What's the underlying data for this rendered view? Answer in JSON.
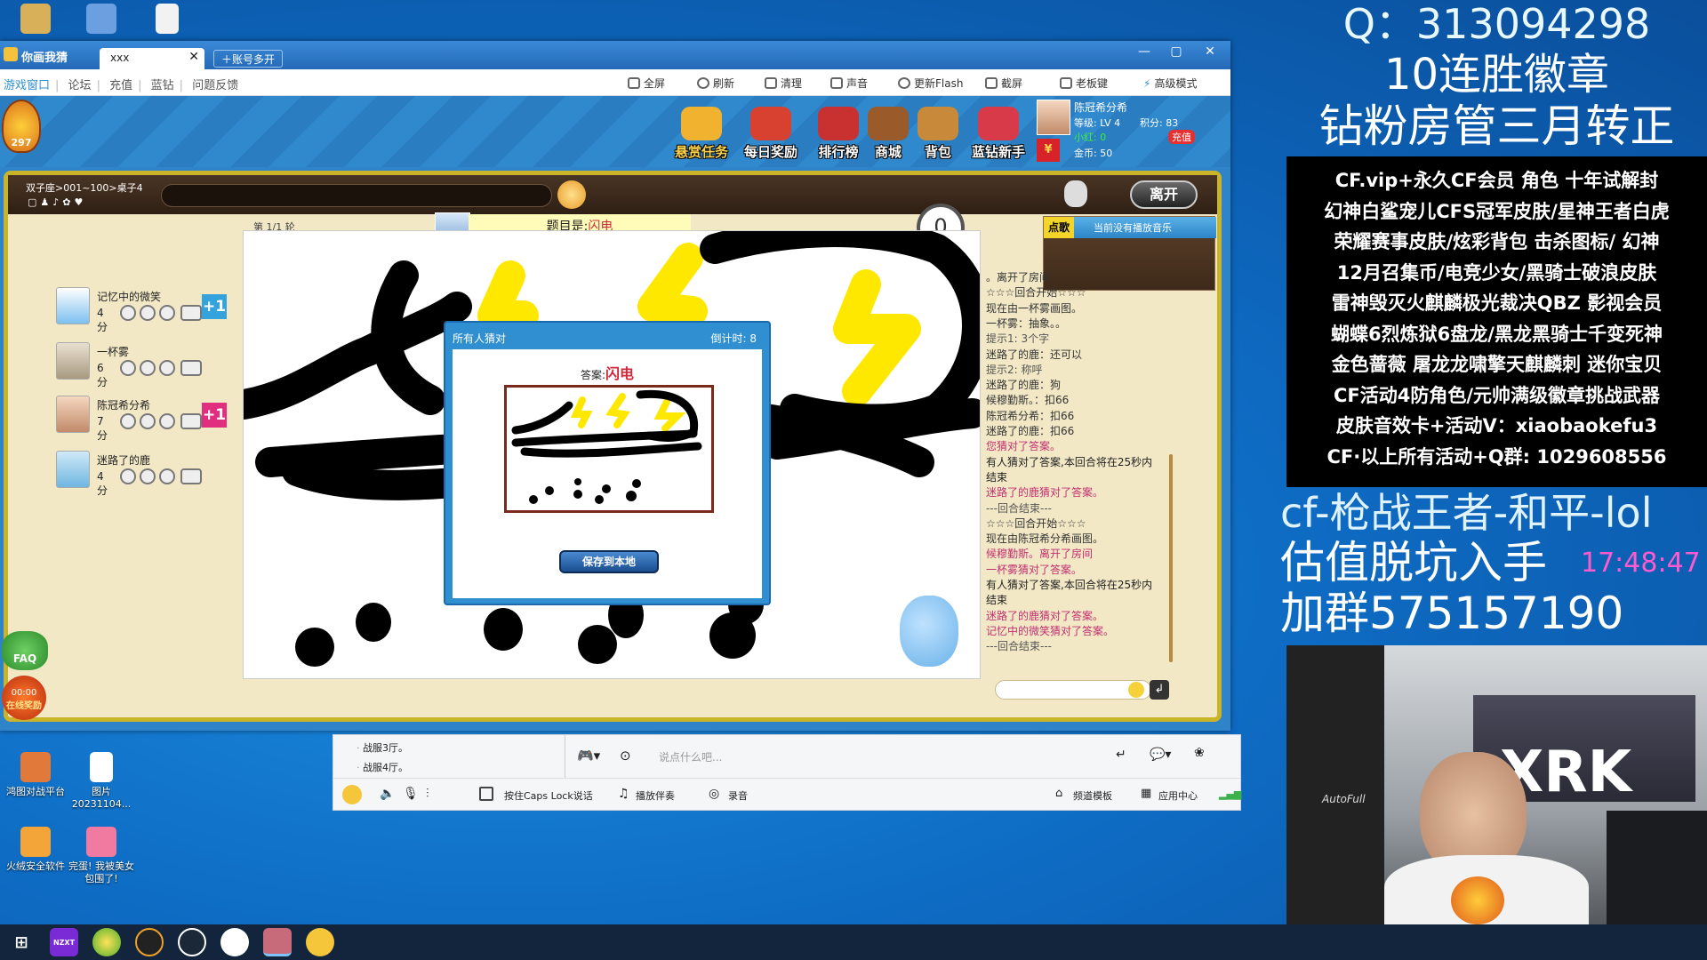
{
  "window": {
    "app_title": "你画我猜",
    "tab_label": "xxx",
    "new_tab_label": "账号多开"
  },
  "menu": {
    "left_links": [
      "游戏窗口",
      "论坛",
      "充值",
      "蓝钻",
      "问题反馈"
    ],
    "tools": [
      "全屏",
      "刷新",
      "清理",
      "声音",
      "更新Flash",
      "截屏",
      "老板键",
      "高级模式"
    ]
  },
  "game": {
    "level_badge": "297",
    "buttons": [
      "悬赏任务",
      "每日奖励",
      "排行榜",
      "商城",
      "背包",
      "蓝钻新手"
    ],
    "user": {
      "name": "陈冠希分希",
      "level": "等级: LV 4",
      "points": "积分: 83",
      "small_red": "小红: 0",
      "recharge": "充值",
      "gold": "金币: 50",
      "vip_mark": "¥"
    },
    "room_path": "双子座>001~100>桌子4",
    "leave_button": "离开",
    "round_label": "第 1/1 轮",
    "topic_label": "题目是:",
    "topic_value": "闪电",
    "timer_value": "0",
    "music_tab": "点歌",
    "music_status": "当前没有播放音乐",
    "faq": "FAQ",
    "online_time": "00:00",
    "online_label": "在线奖励"
  },
  "players": [
    {
      "name": "记忆中的微笑",
      "score": "4分",
      "bonus": "+1",
      "bonus_color": "#34a3dc"
    },
    {
      "name": "一杯雾",
      "score": "6分",
      "bonus": "",
      "bonus_color": ""
    },
    {
      "name": "陈冠希分希",
      "score": "7分",
      "bonus": "+1",
      "bonus_color": "#e02f7e"
    },
    {
      "name": "迷路了的鹿",
      "score": "4分",
      "bonus": "",
      "bonus_color": ""
    }
  ],
  "chat": [
    {
      "text": "。离开了房间",
      "color": "#333"
    },
    {
      "text": "☆☆☆回合开始☆☆☆",
      "color": "#333"
    },
    {
      "text": "现在由一杯雾画图。",
      "color": "#333"
    },
    {
      "text": "一杯雾：抽象。。",
      "color": "#333"
    },
    {
      "text": "提示1: 3个字",
      "color": "#555"
    },
    {
      "text": "迷路了的鹿：还可以",
      "color": "#333"
    },
    {
      "text": "提示2: 称呼",
      "color": "#555"
    },
    {
      "text": "迷路了的鹿：狗",
      "color": "#333"
    },
    {
      "text": "候穆勤斯。：扣66",
      "color": "#333"
    },
    {
      "text": "陈冠希分希：扣66",
      "color": "#333"
    },
    {
      "text": "迷路了的鹿：扣66",
      "color": "#333"
    },
    {
      "text": "您猜对了答案。",
      "color": "#c03070"
    },
    {
      "text": "有人猜对了答案,本回合将在25秒内",
      "color": "#222"
    },
    {
      "text": "结束",
      "color": "#222"
    },
    {
      "text": "迷路了的鹿猜对了答案。",
      "color": "#c03070"
    },
    {
      "text": "---回合结束---",
      "color": "#555"
    },
    {
      "text": "☆☆☆回合开始☆☆☆",
      "color": "#333"
    },
    {
      "text": "现在由陈冠希分希画图。",
      "color": "#333"
    },
    {
      "text": "候穆勤斯。离开了房间",
      "color": "#c03070"
    },
    {
      "text": "一杯雾猜对了答案。",
      "color": "#c03070"
    },
    {
      "text": "有人猜对了答案,本回合将在25秒内",
      "color": "#222"
    },
    {
      "text": "结束",
      "color": "#222"
    },
    {
      "text": "迷路了的鹿猜对了答案。",
      "color": "#c03070"
    },
    {
      "text": "记忆中的微笑猜对了答案。",
      "color": "#c03070"
    },
    {
      "text": "---回合结束---",
      "color": "#555"
    }
  ],
  "modal": {
    "title": "所有人猜对",
    "countdown": "倒计时: 8",
    "answer_label": "答案:",
    "answer_value": "闪电",
    "save_button": "保存到本地"
  },
  "bottom": {
    "channels": [
      "战服3厅。",
      "战服4厅。"
    ],
    "chat_placeholder": "说点什么吧...",
    "caps_label": "按住Caps Lock说话",
    "accompany": "播放伴奏",
    "record": "录音",
    "template": "频道模板",
    "app_center": "应用中心"
  },
  "desktop": {
    "icons": [
      "鸿图对战平台",
      "图片 20231104...",
      "火绒安全软件",
      "完蛋! 我被美女包围了!"
    ]
  },
  "taskbar": {
    "items": [
      "windows-start",
      "nzxt",
      "browser",
      "game-c",
      "steam",
      "qq",
      "paint-game",
      "bear-app"
    ]
  },
  "overlay": {
    "qq": "Q：313094298",
    "badge": "10连胜徽章",
    "manager": "钻粉房管三月转正",
    "promo_lines": [
      "CF.vip+永久CF会员 角色 十年试解封",
      "幻神白鲨宠儿CFS冠军皮肤/星神王者白虎",
      "荣耀赛事皮肤/炫彩背包 击杀图标/ 幻神",
      "12月召集币/电竞少女/黑骑士破浪皮肤",
      "雷神毁灭火麒麟极光裁决QBZ 影视会员",
      "蝴蝶6烈炼狱6盘龙/黑龙黑骑士千变死神",
      "金色蔷薇 屠龙龙啸擎天麒麟刺 迷你宝贝",
      "CF活动4防角色/元帅满级徽章挑战武器",
      "皮肤音效卡+活动V：xiaobaokefu3",
      "CF·以上所有活动+Q群: 1029608556"
    ],
    "games": "cf-枪战王者-和平-lol",
    "exit_line": "估值脱坑入手",
    "clock": "17:48:47",
    "group": "加群575157190",
    "cam_brand": "XRK",
    "chair_brand": "AutoFull"
  },
  "colors": {
    "accent_blue": "#2f8fd1",
    "board_gold": "#c9b42a",
    "answer_red": "#d0283a",
    "topic_red": "#d0283a",
    "chat_pink": "#c03070"
  }
}
